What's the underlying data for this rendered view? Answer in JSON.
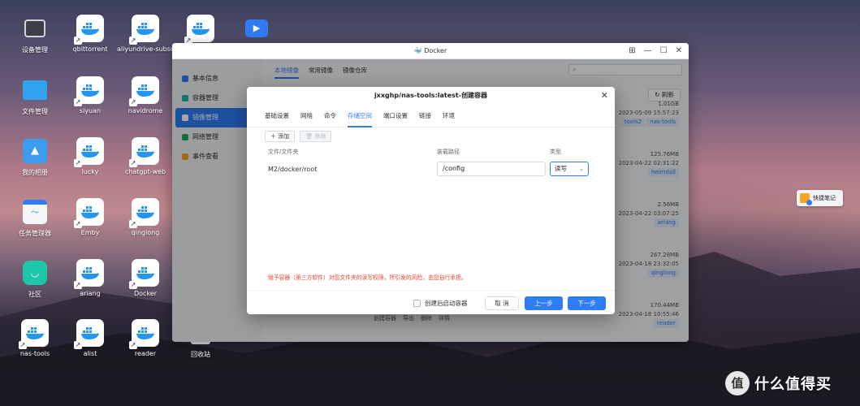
{
  "desktop": {
    "icons": [
      {
        "label": "设备管理",
        "icon": "device-manager-icon"
      },
      {
        "label": "qbittorrent",
        "icon": "docker-icon"
      },
      {
        "label": "aliyundrive-subsc...",
        "icon": "docker-icon"
      },
      {
        "label": "",
        "icon": "docker-icon"
      },
      {
        "label": "",
        "icon": "tv-player-icon"
      },
      {
        "label": "文件管理",
        "icon": "folder-icon"
      },
      {
        "label": "siyuan",
        "icon": "docker-icon"
      },
      {
        "label": "navidrome",
        "icon": "docker-icon"
      },
      {
        "label": "我的相册",
        "icon": "photo-icon"
      },
      {
        "label": "lucky",
        "icon": "docker-icon"
      },
      {
        "label": "chatgpt-web",
        "icon": "docker-icon"
      },
      {
        "label": "任务管理器",
        "icon": "task-monitor-icon"
      },
      {
        "label": "Emby",
        "icon": "docker-icon"
      },
      {
        "label": "qinglong",
        "icon": "docker-icon"
      },
      {
        "label": "社区",
        "icon": "community-icon"
      },
      {
        "label": "ariang",
        "icon": "docker-icon"
      },
      {
        "label": "Docker",
        "icon": "docker-icon"
      },
      {
        "label": "nas-tools",
        "icon": "docker-icon"
      },
      {
        "label": "alist",
        "icon": "docker-icon"
      },
      {
        "label": "reader",
        "icon": "docker-icon"
      },
      {
        "label": "回收站",
        "icon": "trash-icon"
      }
    ]
  },
  "window": {
    "title": "Docker",
    "sidebar": [
      {
        "label": "基本信息",
        "color": "#2f7cf6"
      },
      {
        "label": "容器管理",
        "color": "#1fb5a7"
      },
      {
        "label": "镜像管理",
        "color": "#2f7cf6"
      },
      {
        "label": "网络管理",
        "color": "#27a85f"
      },
      {
        "label": "事件查看",
        "color": "#f5a623"
      }
    ],
    "tabs": [
      "本地镜像",
      "常用镜像",
      "镜像仓库"
    ],
    "refresh_label": "刷新",
    "images": [
      {
        "size": "1.01GB",
        "date": "2023-05-09 15:57:23",
        "tag": "tools2",
        "tag2": "nas-tools"
      },
      {
        "size": "125.76MB",
        "date": "2023-04-22 02:31:22",
        "tag": "heimdall",
        "tag2": ""
      },
      {
        "size": "2.56MB",
        "date": "2023-04-22 03:07:25",
        "tag": "ariang",
        "tag2": ""
      },
      {
        "size": "267.28MB",
        "date": "2023-04-18 23:32:05",
        "tag": "qinglong",
        "tag2": ""
      },
      {
        "size": "170.44MB",
        "date": "2023-04-18 10:55:46",
        "tag": "reader",
        "tag2": ""
      }
    ],
    "bottom_actions": [
      "创建容器",
      "导出",
      "删除",
      "详情"
    ]
  },
  "dialog": {
    "title": "jxxghp/nas-tools:latest-创建容器",
    "tabs": [
      "基础设置",
      "网络",
      "命令",
      "存储空间",
      "端口设置",
      "链接",
      "环境"
    ],
    "active_tab": "存储空间",
    "add_label": "添加",
    "remove_label": "移除",
    "columns": {
      "folder": "文件/文件夹",
      "mount": "装载路径",
      "type": "类型"
    },
    "row": {
      "folder": "M2/docker/root",
      "mount": "/config",
      "type": "读写"
    },
    "warning": "赋予容器（第三方软件）对您文件夹的读写权限，所引发的风险，由您自行承担。",
    "autostart_label": "创建后启动容器",
    "cancel_label": "取 消",
    "prev_label": "上一步",
    "next_label": "下一步"
  },
  "quick_note": {
    "label": "快捷笔记"
  },
  "watermark": {
    "text": "什么值得买",
    "badge": "值"
  }
}
